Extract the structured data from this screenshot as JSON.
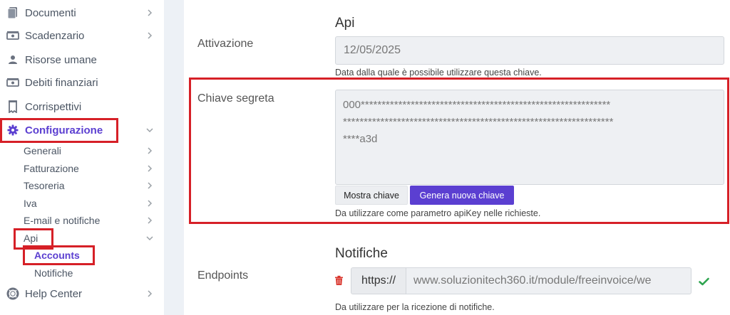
{
  "sidebar": {
    "items": [
      {
        "label": "Documenti",
        "icon": "document-icon"
      },
      {
        "label": "Scadenzario",
        "icon": "money-icon"
      },
      {
        "label": "Risorse umane",
        "icon": "person-icon"
      },
      {
        "label": "Debiti finanziari",
        "icon": "money-icon"
      },
      {
        "label": "Corrispettivi",
        "icon": "receipt-icon"
      },
      {
        "label": "Configurazione",
        "icon": "gear-icon"
      }
    ],
    "config_subitems": [
      "Generali",
      "Fatturazione",
      "Tesoreria",
      "Iva",
      "E-mail e notifiche",
      "Api"
    ],
    "api_subitems": [
      "Accounts",
      "Notifiche"
    ],
    "help": {
      "label": "Help Center",
      "icon": "lifebuoy-icon"
    }
  },
  "main": {
    "api_section_title": "Api",
    "activation": {
      "label": "Attivazione",
      "value": "12/05/2025",
      "help": "Data dalla quale è possibile utilizzare questa chiave."
    },
    "secret": {
      "label": "Chiave segreta",
      "line1": "000************************************************************",
      "line2": "*****************************************************************",
      "line3": "****a3d",
      "show_button": "Mostra chiave",
      "generate_button": "Genera nuova chiave",
      "help": "Da utilizzare come parametro apiKey nelle richieste."
    },
    "notifications_title": "Notifiche",
    "endpoints": {
      "label": "Endpoints",
      "prefix": "https://",
      "url": "www.soluzionitech360.it/module/freeinvoice/we",
      "help": "Da utilizzare per la ricezione di notifiche."
    }
  },
  "colors": {
    "accent": "#5b3fd1",
    "highlight_red": "#d62027",
    "delete_red": "#d9342b",
    "check_green": "#2ea44f"
  }
}
